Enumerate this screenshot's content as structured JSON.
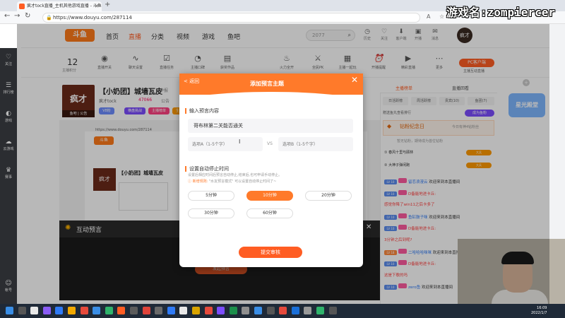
{
  "browser": {
    "tab_title": "疯才tock直播_主机其他游戏直播 - 斗鱼",
    "url": "https://www.douyu.com/287114",
    "new_tab": "+"
  },
  "overlay": {
    "game_name": "游戏名:zompiercer"
  },
  "site": {
    "logo": "斗鱼",
    "nav": [
      "首页",
      "直播",
      "分类",
      "视频",
      "游戏",
      "鱼吧"
    ],
    "active_nav": "直播",
    "search_value": "2077",
    "header_icons": [
      "历史",
      "关注",
      "客户端",
      "开播",
      "消息"
    ],
    "user_avatar": "疯才"
  },
  "leftbar": {
    "items": [
      "关注",
      "排行榜",
      "游戏",
      "云游戏",
      "赛事",
      "帐号"
    ]
  },
  "toolrow": {
    "level_value": "12",
    "level_label": "主播积分",
    "tools": [
      "直播开关",
      "聊天设置",
      "直播任务",
      "主播口碑",
      "获奖作品",
      "火力全开",
      "全民PK",
      "主播一起玩",
      "开播提醒",
      "精彩直播",
      "更多"
    ],
    "pc_client": "PC客户端",
    "pc_client_sub": "主播互动直播"
  },
  "room": {
    "avatar_text": "疯才",
    "avatar_sub": "鱼吧 | 公告",
    "title": "【小奶团】城墙瓦皮",
    "report": "举报",
    "streamer": "疯才tock",
    "heat": "47066",
    "category": "公告",
    "badges": [
      {
        "text": "V8粉",
        "color": "#6c8cff"
      },
      {
        "text": "横盘挑战",
        "color": "#7c4dff"
      },
      {
        "text": "主播榜单",
        "color": "#ff4081"
      },
      {
        "text": "生日",
        "color": "#ff9a00"
      }
    ]
  },
  "video": {
    "inner_url": "https://www.douyu.com/287114",
    "inner_logo": "斗鱼",
    "inner_avatar": "疯才",
    "inner_title": "【小奶团】城墙瓦皮",
    "interact_title": "互动预言",
    "interact_button": "发起预言"
  },
  "chat": {
    "tabs": [
      "主播榜单",
      "直播回看"
    ],
    "subtabs": [
      "日活跃榜",
      "周活跃榜",
      "贵宾(10)",
      "鱼团(7)"
    ],
    "rank_row": "赠送鱼丸查看排行",
    "become_fan": "成为鱼粉",
    "badge_title": "钻粉纪念日",
    "badge_sub": "今日有神4钻粉丝",
    "badge_note": "暂无钻粉，期待成为首位钻粉",
    "rankers": [
      {
        "name": "春风十里与顾林",
        "gift": "大兵"
      },
      {
        "name": "大神子弹闲跑",
        "gift": "大兵"
      }
    ],
    "messages": [
      {
        "lv": "LV 10",
        "lvc": "blue",
        "name": "留恋浪漫云",
        "msg": "欢迎来到本直播间",
        "namec": "",
        "msgc": ""
      },
      {
        "lv": "LV 10",
        "lvc": "blue",
        "name": "",
        "msg": "D备能地进卡丘:",
        "namec": "",
        "msgc": "red"
      },
      {
        "lv": "",
        "lvc": "",
        "name": "",
        "msg": "感觉你降了win11之后卡多了",
        "namec": "",
        "msgc": "red"
      },
      {
        "lv": "LV 10",
        "lvc": "blue",
        "name": "鱼缸鼓子咪",
        "msg": "欢迎来到本直播间",
        "namec": "",
        "msgc": ""
      },
      {
        "lv": "LV 10",
        "lvc": "blue",
        "name": "",
        "msg": "D备能地进卡丘:",
        "namec": "",
        "msgc": "red"
      },
      {
        "lv": "",
        "lvc": "",
        "name": "",
        "msg": "3分钟之后到呢?",
        "namec": "",
        "msgc": "red"
      },
      {
        "lv": "LV 18",
        "lvc": "orange",
        "name": "二哈哈哈咪咪",
        "msg": "欢迎来到本直播间",
        "namec": "",
        "msgc": ""
      },
      {
        "lv": "LV 10",
        "lvc": "blue",
        "name": "",
        "msg": "D备能地进卡丘:",
        "namec": "",
        "msgc": "red"
      },
      {
        "lv": "",
        "lvc": "",
        "name": "",
        "msg": "这是下歌的吗",
        "namec": "",
        "msgc": "red"
      },
      {
        "lv": "LV 10",
        "lvc": "blue",
        "name": "zero鱼",
        "msg": "欢迎来到本直播间",
        "namec": "",
        "msgc": ""
      }
    ]
  },
  "rightrail": {
    "promo": "星光殿堂",
    "plus": "+"
  },
  "modal": {
    "back": "< 返回",
    "title": "添加预言主题",
    "close": "✕",
    "section1": "输入预言内容",
    "topic_value": "哥布林第二关能否通关",
    "optA_placeholder": "选项A（1-5个字）",
    "optB_placeholder": "选项B（1-5个字）",
    "vs": "VS",
    "section2": "设置自动停止时间",
    "auto_note": "设置后相应时间后预言自动停止,结束后,也可申请手动停止。",
    "new_skill_prefix": "新增规则:",
    "new_skill_text": "\"水友预言模式\" 可以设置自动停止时间了~",
    "durations": [
      "5分钟",
      "10分钟",
      "20分钟",
      "30分钟",
      "60分钟"
    ],
    "active_duration": "10分钟",
    "submit": "提交审核"
  },
  "taskbar": {
    "time": "16:09",
    "date": "2022/1/7"
  }
}
